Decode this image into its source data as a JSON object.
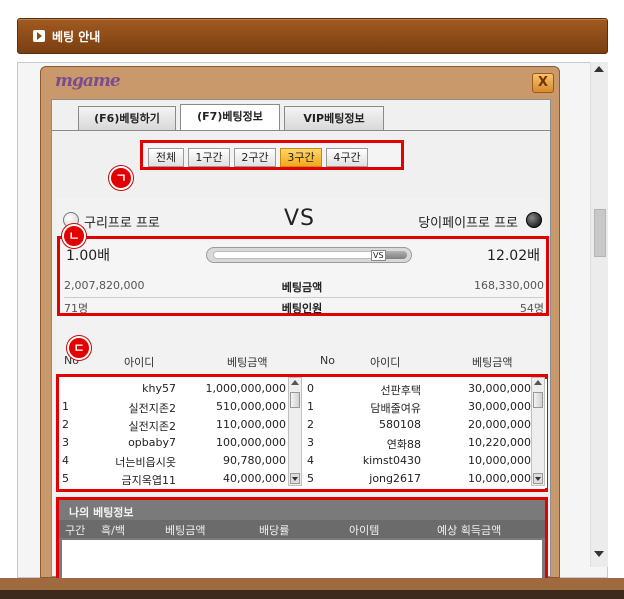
{
  "header": {
    "title": "베팅 안내"
  },
  "game": {
    "logo_text": "mgame",
    "close_label": "X",
    "tabs": [
      {
        "label": "(F6)베팅하기"
      },
      {
        "label": "(F7)베팅정보"
      },
      {
        "label": "VIP베팅정보"
      }
    ],
    "active_tab": 1,
    "filters": [
      {
        "label": "전체"
      },
      {
        "label": "1구간"
      },
      {
        "label": "2구간"
      },
      {
        "label": "3구간"
      },
      {
        "label": "4구간"
      }
    ],
    "active_filter": 3,
    "markers": [
      "ㄱ",
      "ㄴ",
      "ㄷ"
    ],
    "match": {
      "team_left": "구리프로 프로",
      "vs": "VS",
      "team_right": "당이페이프로 프로",
      "odds_left": "1.00배",
      "odds_right": "12.02배",
      "odds_bar_vs": "VS",
      "odds_bar_share_right": 0.077,
      "bet_amount_label": "베팅금액",
      "bet_amount_left": "2,007,820,000",
      "bet_amount_right": "168,330,000",
      "bet_people_label": "베팅인원",
      "bet_people_left": "71명",
      "bet_people_right": "54명"
    },
    "list_headers": {
      "left": {
        "no": "No",
        "id": "아이디",
        "amount": "베팅금액"
      },
      "right": {
        "no": "No",
        "id": "아이디",
        "amount": "베팅금액"
      }
    },
    "left_rows": [
      {
        "no": "",
        "id": "khy57",
        "amount": "1,000,000,000"
      },
      {
        "no": "1",
        "id": "실전지존2",
        "amount": "510,000,000"
      },
      {
        "no": "2",
        "id": "실전지존2",
        "amount": "110,000,000"
      },
      {
        "no": "3",
        "id": "opbaby7",
        "amount": "100,000,000"
      },
      {
        "no": "4",
        "id": "너는비읍시옷",
        "amount": "90,780,000"
      },
      {
        "no": "5",
        "id": "금지옥엽11",
        "amount": "40,000,000"
      }
    ],
    "right_rows": [
      {
        "no": "0",
        "id": "선판후택",
        "amount": "30,000,000"
      },
      {
        "no": "1",
        "id": "담배줄여유",
        "amount": "30,000,000"
      },
      {
        "no": "2",
        "id": "580108",
        "amount": "20,000,000"
      },
      {
        "no": "3",
        "id": "연화88",
        "amount": "10,220,000"
      },
      {
        "no": "4",
        "id": "kimst0430",
        "amount": "10,000,000"
      },
      {
        "no": "5",
        "id": "jong2617",
        "amount": "10,000,000"
      }
    ],
    "my_bets": {
      "title": "나의 베팅정보",
      "columns": [
        "구간",
        "흑/백",
        "베팅금액",
        "배당률",
        "아이템",
        "예상 획득금액"
      ]
    }
  }
}
